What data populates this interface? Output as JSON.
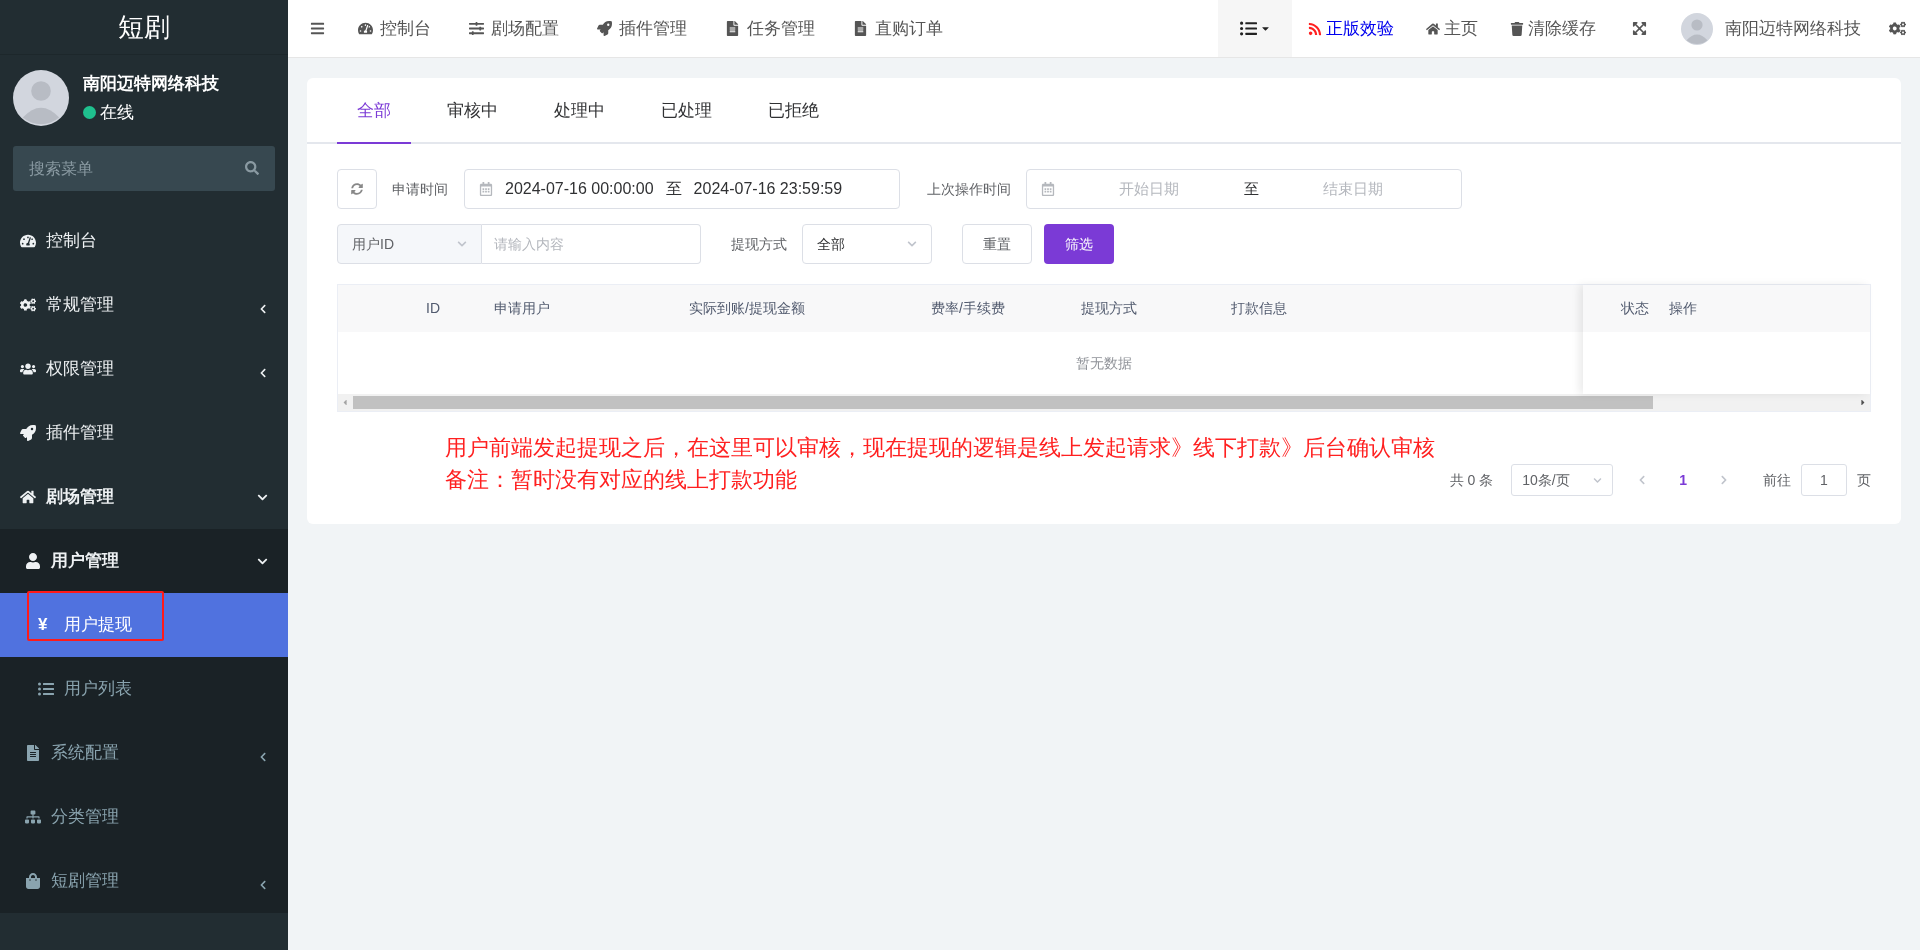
{
  "sidebar": {
    "logo": "短剧",
    "user": {
      "name": "南阳迈特网络科技",
      "status": "在线",
      "online": true
    },
    "search": {
      "placeholder": "搜索菜单"
    },
    "menu": [
      {
        "kind": "link",
        "label": "控制台",
        "selected": false,
        "annotated": false
      },
      {
        "kind": "group",
        "label": "常规管理",
        "expanded": false
      },
      {
        "kind": "group",
        "label": "权限管理",
        "expanded": false
      },
      {
        "kind": "link",
        "label": "插件管理",
        "selected": false,
        "annotated": false
      },
      {
        "kind": "group",
        "label": "剧场管理",
        "expanded": true,
        "children": [
          {
            "kind": "group",
            "label": "用户管理",
            "expanded": true,
            "children": [
              {
                "kind": "link",
                "glyph": "¥",
                "label": "用户提现",
                "selected": true,
                "annotated": true
              },
              {
                "kind": "link",
                "label": "用户列表",
                "selected": false,
                "annotated": false
              }
            ]
          },
          {
            "kind": "group",
            "label": "系统配置",
            "expanded": false
          },
          {
            "kind": "link",
            "label": "分类管理",
            "selected": false,
            "annotated": false
          },
          {
            "kind": "group",
            "label": "短剧管理",
            "expanded": false
          }
        ]
      }
    ]
  },
  "top_nav": {
    "left": [
      "控制台",
      "剧场配置",
      "插件管理",
      "任务管理",
      "直购订单"
    ],
    "right": [
      {
        "kind": "promo",
        "label": "正版效验"
      },
      {
        "kind": "plain",
        "label": "主页"
      },
      {
        "kind": "plain",
        "label": "清除缓存"
      }
    ],
    "user": "南阳迈特网络科技"
  },
  "tabs": [
    {
      "label": "全部",
      "selected": true
    },
    {
      "label": "审核中",
      "selected": false
    },
    {
      "label": "处理中",
      "selected": false
    },
    {
      "label": "已处理",
      "selected": false
    },
    {
      "label": "已拒绝",
      "selected": false
    }
  ],
  "filters": {
    "apply_time": {
      "label": "申请时间",
      "start": "2024-07-16 00:00:00",
      "separator": "至",
      "end": "2024-07-16 23:59:59"
    },
    "last_op_time": {
      "label": "上次操作时间",
      "start_placeholder": "开始日期",
      "separator": "至",
      "end_placeholder": "结束日期"
    },
    "field_select": "用户ID",
    "keyword_placeholder": "请输入内容",
    "method": {
      "label": "提现方式",
      "value": "全部"
    },
    "buttons": [
      "重置",
      "筛选"
    ]
  },
  "table": {
    "columns": [
      "ID",
      "申请用户",
      "实际到账/提现金额",
      "费率/手续费",
      "提现方式",
      "打款信息"
    ],
    "fixed_columns": [
      "状态",
      "操作"
    ],
    "empty_text": "暂无数据"
  },
  "annotation": [
    "用户前端发起提现之后，在这里可以审核，现在提现的逻辑是线上发起请求》线下打款》后台确认审核",
    "备注：暂时没有对应的线上打款功能"
  ],
  "pagination": {
    "total": "共 0 条",
    "page_size": "10条/页",
    "pages": [
      {
        "label": "1",
        "selected": true
      }
    ],
    "jump_label": "前往",
    "jump_value": "1",
    "jump_suffix": "页"
  }
}
